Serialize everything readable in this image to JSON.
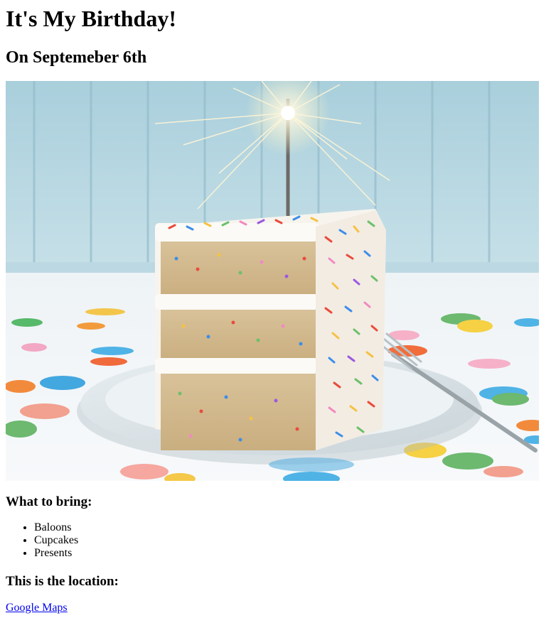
{
  "page": {
    "title": "It's My Birthday!",
    "subtitle": "On Septemeber 6th"
  },
  "image": {
    "icon": "birthday-cake-slice-with-sparkler-photo"
  },
  "bring": {
    "heading": "What to bring:",
    "items": [
      "Baloons",
      "Cupcakes",
      "Presents"
    ]
  },
  "location": {
    "heading": "This is the location:",
    "link_text": "Google Maps"
  },
  "colors": {
    "link": "#0000ee",
    "background": "#ffffff",
    "text": "#000000"
  }
}
